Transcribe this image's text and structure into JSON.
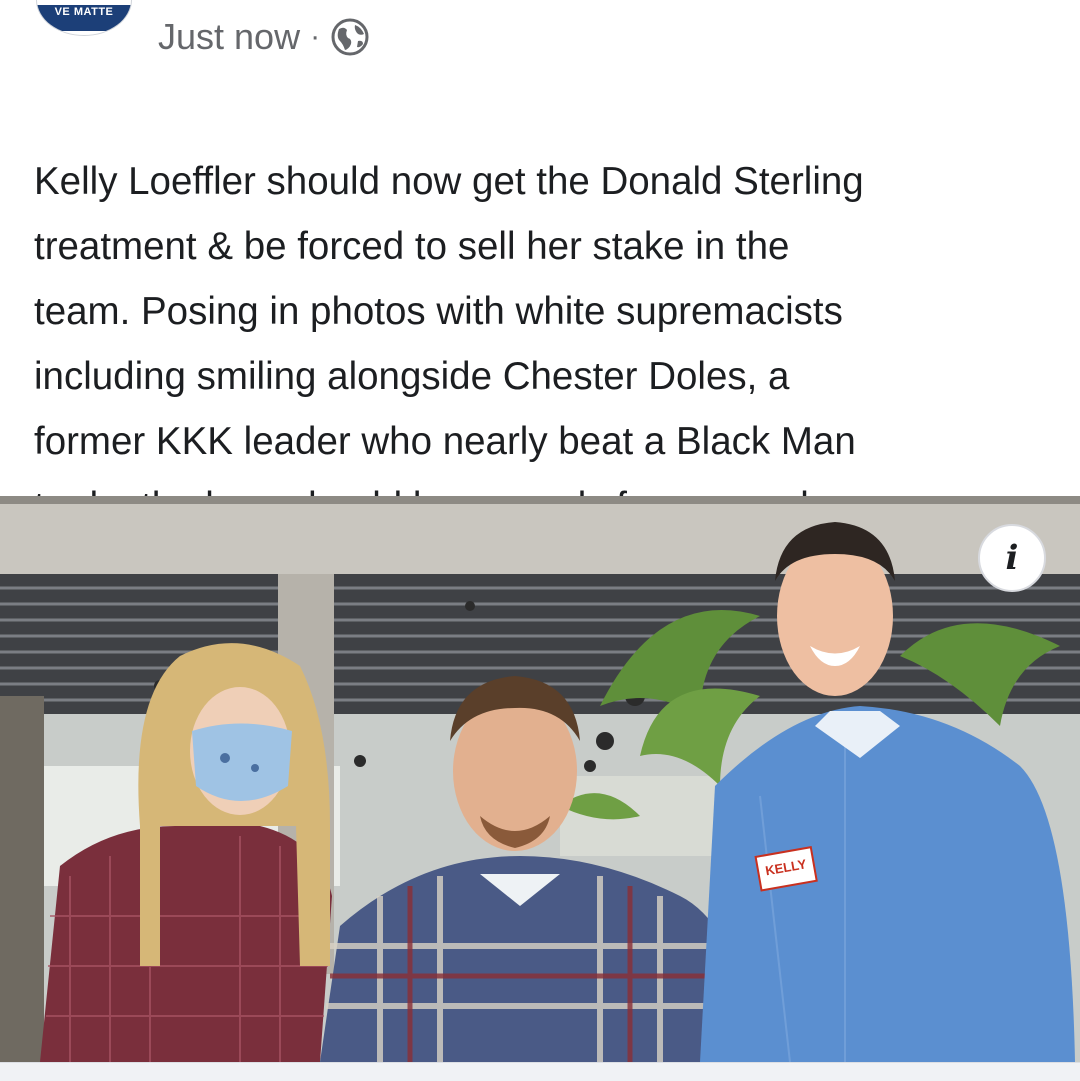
{
  "post": {
    "avatar_text": "VE MATTE",
    "timestamp": "Just now",
    "separator": "·",
    "privacy_icon": "globe-icon",
    "body_lines": [
      "Kelly Loeffler should now get the Donald Sterling",
      "treatment & be forced to sell her stake in the",
      "team. Posing in photos with white supremacists",
      "including smiling alongside Chester Doles, a",
      "former KKK leader who nearly beat a Black Man",
      "to death alone should be grounds for removal"
    ]
  },
  "photo": {
    "info_label": "i",
    "sticker_text": "KELLY"
  },
  "colors": {
    "text": "#1c1e21",
    "meta": "#65676b",
    "shirt_blue": "#5b8fd0",
    "plaid": "#7a2f3c"
  }
}
